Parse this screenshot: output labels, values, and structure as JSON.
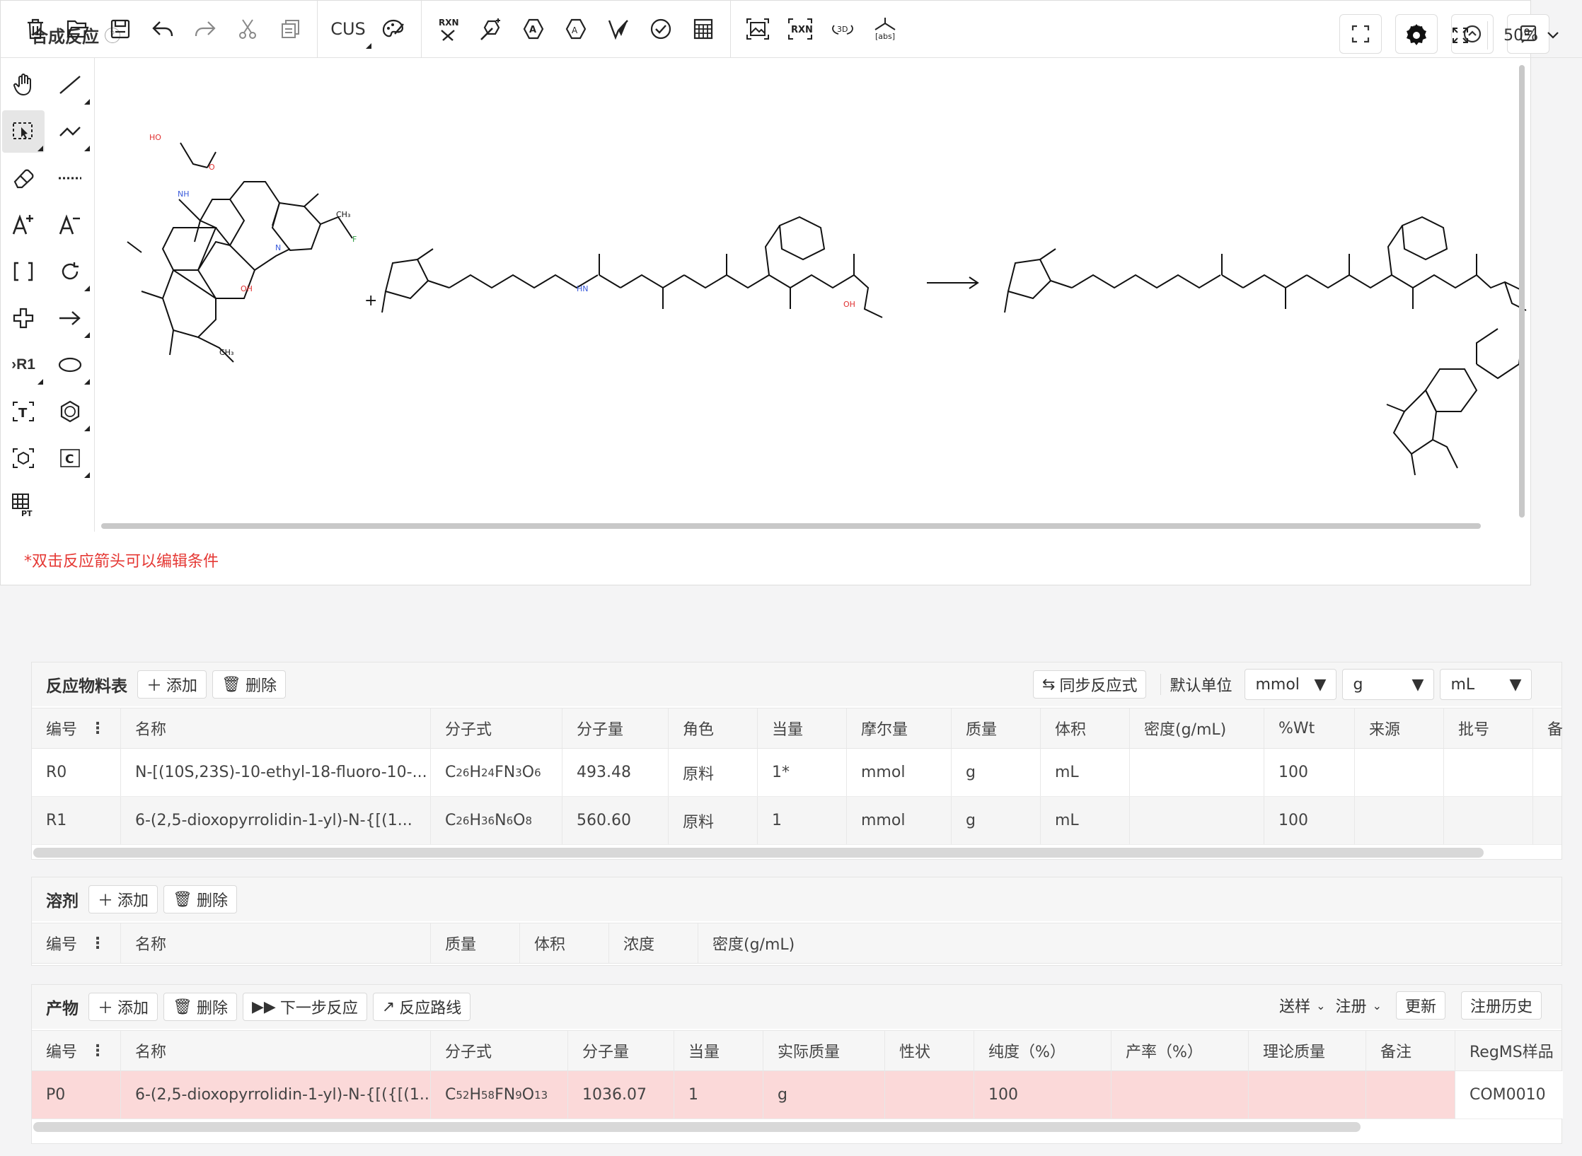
{
  "page": {
    "title": "合成反应",
    "help": "?"
  },
  "toolbar": {
    "cus_label": "CUS",
    "rxn_label": "RXN",
    "rxn2_label": "RXN",
    "three_d": "3D",
    "abs_label": "[abs]",
    "zoom": "50%"
  },
  "leftbar": {
    "r1": "›R1",
    "c": "C",
    "t": "T",
    "pt": "PT"
  },
  "canvas": {
    "plus": "+",
    "atoms": {
      "ho": "HO",
      "o": "O",
      "nh": "NH",
      "hn": "HN",
      "n": "N",
      "f": "F",
      "oh": "OH",
      "ch3": "CH₃",
      "ch3b": "CH₃"
    }
  },
  "note": "*双击反应箭头可以编辑条件",
  "reactants": {
    "name": "反应物料表",
    "add": "添加",
    "delete": "删除",
    "sync": "同步反应式",
    "default_unit": "默认单位",
    "units": [
      "mmol",
      "g",
      "mL"
    ],
    "headers": [
      "编号",
      "名称",
      "分子式",
      "分子量",
      "角色",
      "当量",
      "摩尔量",
      "质量",
      "体积",
      "密度(g/mL)",
      "%Wt",
      "来源",
      "批号",
      "备"
    ],
    "rows": [
      {
        "id": "R0",
        "name": "N-[(10S,23S)-10-ethyl-18-fluoro-10-...",
        "formula": [
          "C",
          "26",
          "H",
          "24",
          "FN",
          "3",
          "O",
          "6"
        ],
        "mw": "493.48",
        "role": "原料",
        "eq": "1*",
        "mol": "mmol",
        "mass": "g",
        "vol": "mL",
        "density": "",
        "wt": "100"
      },
      {
        "id": "R1",
        "name": "6-(2,5-dioxopyrrolidin-1-yl)-N-{[(1...",
        "formula": [
          "C",
          "26",
          "H",
          "36",
          "N",
          "6",
          "O",
          "8"
        ],
        "mw": "560.60",
        "role": "原料",
        "eq": "1",
        "mol": "mmol",
        "mass": "g",
        "vol": "mL",
        "density": "",
        "wt": "100"
      }
    ]
  },
  "solvents": {
    "name": "溶剂",
    "add": "添加",
    "delete": "删除",
    "headers": [
      "编号",
      "名称",
      "质量",
      "体积",
      "浓度",
      "密度(g/mL)"
    ]
  },
  "products": {
    "name": "产物",
    "add": "添加",
    "delete": "删除",
    "next": "下一步反应",
    "route": "反应路线",
    "send": "送样",
    "register": "注册",
    "update": "更新",
    "history": "注册历史",
    "headers": [
      "编号",
      "名称",
      "分子式",
      "分子量",
      "当量",
      "实际质量",
      "性状",
      "纯度（%）",
      "产率（%）",
      "理论质量",
      "备注",
      "RegMS样品"
    ],
    "rows": [
      {
        "id": "P0",
        "name": "6-(2,5-dioxopyrrolidin-1-yl)-N-{[({[(1...",
        "formula": [
          "C",
          "52",
          "H",
          "58",
          "FN",
          "9",
          "O",
          "13"
        ],
        "mw": "1036.07",
        "eq": "1",
        "mass": "g",
        "purity": "100",
        "reg": "COM0010"
      }
    ]
  },
  "colors": {
    "accent": "#1a73e8",
    "note": "#e53935",
    "product_row": "#fbd9d9",
    "n_atom": "#3b5bdb",
    "o_atom": "#e03131",
    "f_atom": "#2f9e44"
  }
}
